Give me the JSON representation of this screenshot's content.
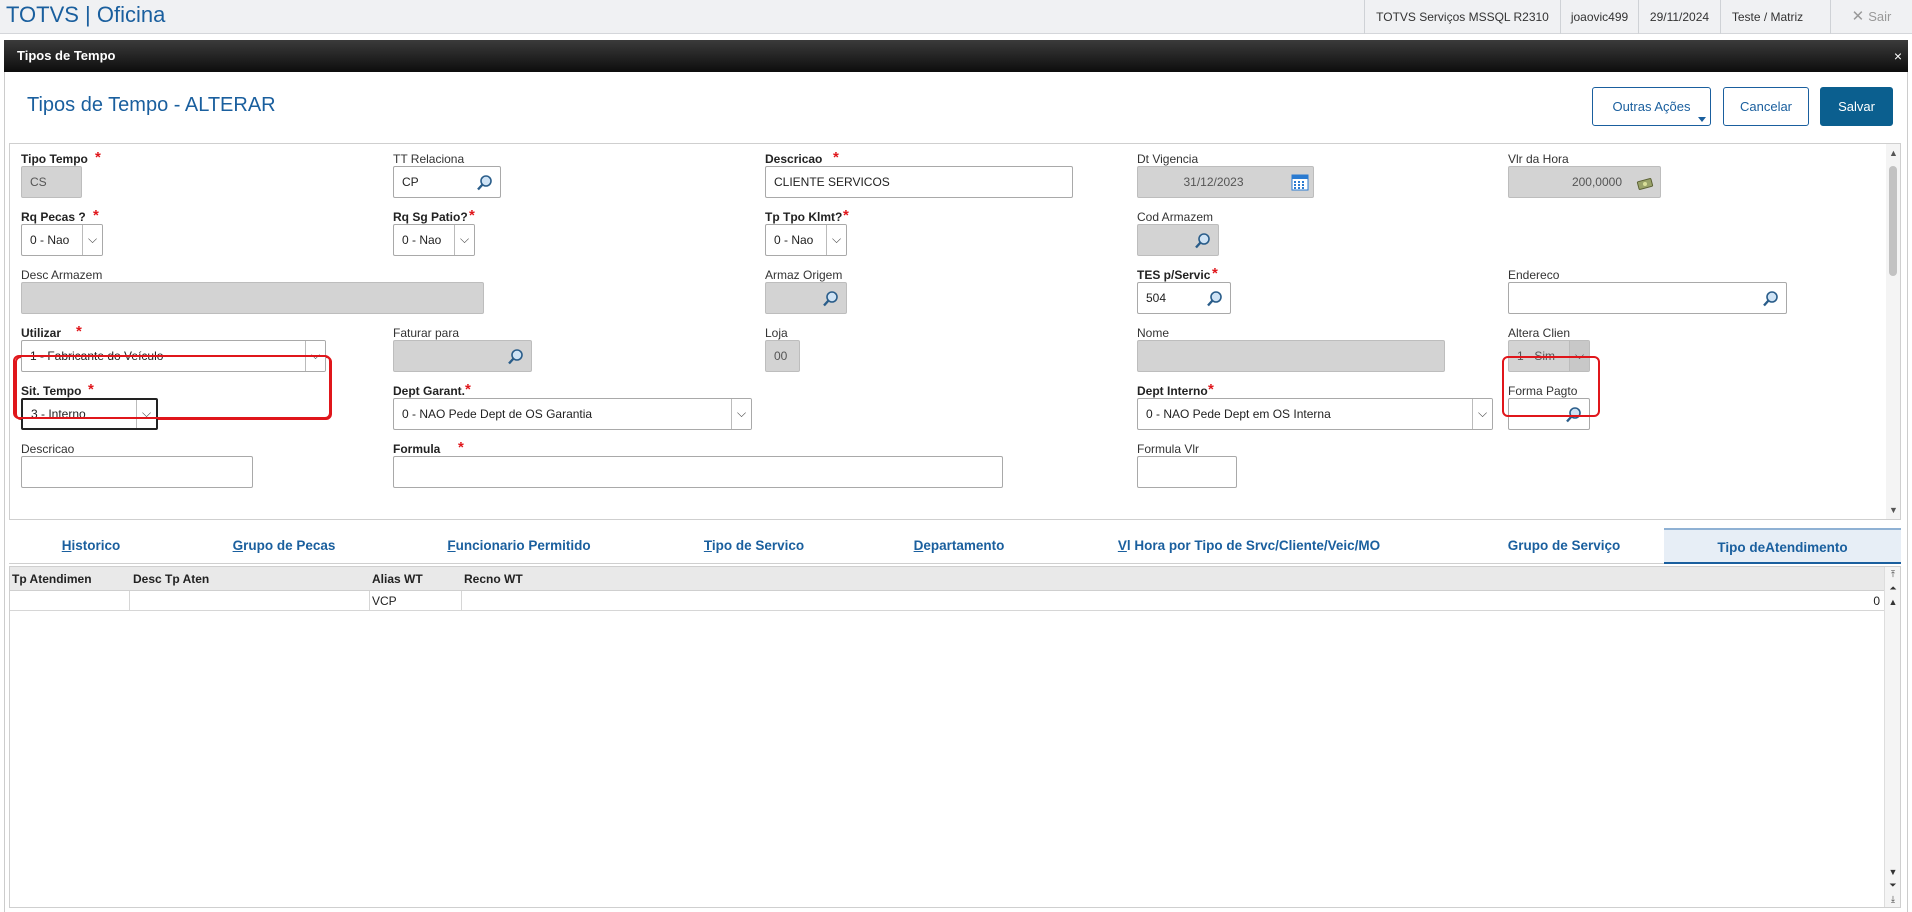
{
  "app": {
    "title": "TOTVS | Oficina",
    "env": "TOTVS Serviços MSSQL R2310",
    "user": "joaovic499",
    "date": "29/11/2024",
    "branch": "Teste / Matriz",
    "exit_label": "Sair"
  },
  "window": {
    "title": "Tipos de Tempo",
    "close": "×"
  },
  "page": {
    "title": "Tipos de Tempo - ALTERAR",
    "btn_other": "Outras Ações",
    "btn_cancel": "Cancelar",
    "btn_save": "Salvar"
  },
  "form": {
    "tipo_tempo": {
      "label": "Tipo Tempo",
      "value": "CS"
    },
    "tt_relaciona": {
      "label": "TT Relaciona",
      "value": "CP"
    },
    "descricao": {
      "label": "Descricao",
      "value": "CLIENTE SERVICOS"
    },
    "dt_vigencia": {
      "label": "Dt Vigencia",
      "value": "31/12/2023"
    },
    "vlr_hora": {
      "label": "Vlr da Hora",
      "value": "200,0000"
    },
    "rq_pecas": {
      "label": "Rq Pecas ?",
      "value": "0 - Nao"
    },
    "rq_sg_patio": {
      "label": "Rq Sg Patio?",
      "value": "0 - Nao"
    },
    "tp_tpo_klmt": {
      "label": "Tp Tpo Klmt?",
      "value": "0 - Nao"
    },
    "cod_armazem": {
      "label": "Cod Armazem",
      "value": ""
    },
    "desc_armazem": {
      "label": "Desc Armazem",
      "value": ""
    },
    "armaz_origem": {
      "label": "Armaz Origem",
      "value": ""
    },
    "tes_servic": {
      "label": "TES p/Servic",
      "value": "504"
    },
    "endereco": {
      "label": "Endereco",
      "value": ""
    },
    "utilizar": {
      "label": "Utilizar",
      "value": "1 - Fabricante do Veículo"
    },
    "faturar_para": {
      "label": "Faturar para",
      "value": ""
    },
    "loja": {
      "label": "Loja",
      "value": "00"
    },
    "nome": {
      "label": "Nome",
      "value": ""
    },
    "altera_clien": {
      "label": "Altera Clien",
      "value": "1 - Sim"
    },
    "sit_tempo": {
      "label": "Sit. Tempo",
      "value": "3 - Interno"
    },
    "dept_garant": {
      "label": "Dept Garant.",
      "value": "0 - NAO Pede Dept de OS Garantia"
    },
    "dept_interno": {
      "label": "Dept Interno",
      "value": "0 - NAO Pede Dept em OS Interna"
    },
    "forma_pagto": {
      "label": "Forma Pagto",
      "value": ""
    },
    "descricao2": {
      "label": "Descricao"
    },
    "formula": {
      "label": "Formula"
    },
    "formula_vlr": {
      "label": "Formula Vlr"
    }
  },
  "tabs": [
    {
      "label": "Historico",
      "key": "H",
      "rest": "istorico"
    },
    {
      "label": "Grupo de Pecas",
      "key": "G",
      "rest": "rupo de Pecas"
    },
    {
      "label": "Funcionario Permitido",
      "key": "F",
      "rest": "uncionario Permitido"
    },
    {
      "label": "Tipo de Servico",
      "key": "T",
      "rest": "ipo de Servico"
    },
    {
      "label": "Departamento",
      "key": "D",
      "rest": "epartamento"
    },
    {
      "label": "Vl Hora por Tipo de Srvc/Cliente/Veic/MO",
      "key": "V",
      "rest": "l Hora por Tipo de Srvc/Cliente/Veic/MO"
    },
    {
      "label": "Grupo de Serviço",
      "key": "",
      "rest": "Grupo de Serviço"
    },
    {
      "label": "Tipo deAtendimento",
      "key": "",
      "rest": "Tipo deAtendimento",
      "active": true
    }
  ],
  "grid": {
    "columns": [
      "Tp Atendimen",
      "Desc Tp Aten",
      "Alias WT",
      "Recno WT"
    ],
    "rows": [
      {
        "tp_atendimen": "",
        "desc_tp_aten": "",
        "alias_wt": "VCP",
        "recno_wt": "0"
      }
    ]
  },
  "colors": {
    "accent": "#1a5f9e",
    "primary_button": "#0b5f8f",
    "required": "#e0161b",
    "highlight": "#e0161b"
  }
}
